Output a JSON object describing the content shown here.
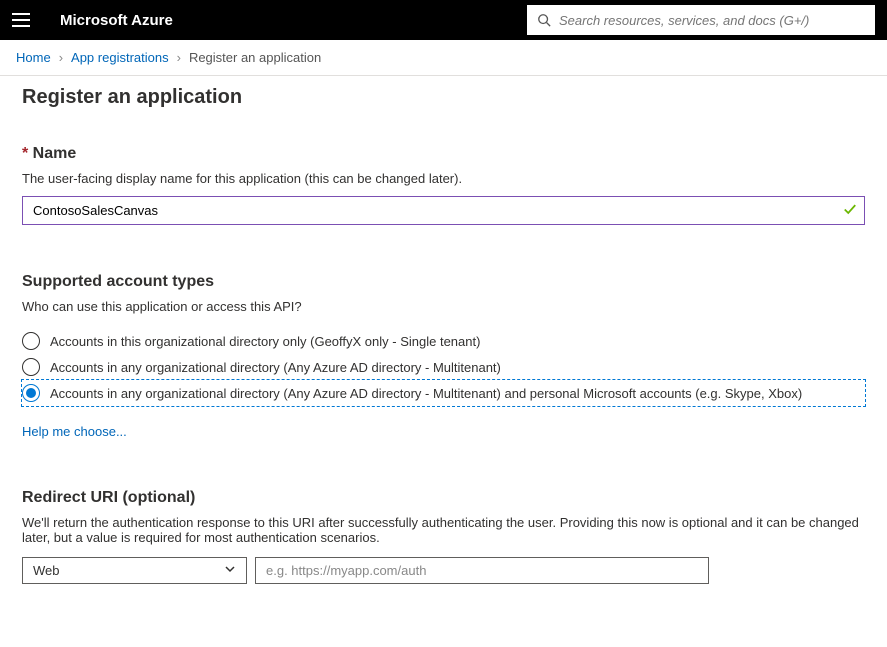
{
  "topbar": {
    "brand": "Microsoft Azure",
    "search_placeholder": "Search resources, services, and docs (G+/)"
  },
  "breadcrumb": {
    "items": [
      "Home",
      "App registrations"
    ],
    "current": "Register an application"
  },
  "page": {
    "title": "Register an application"
  },
  "name": {
    "heading": "Name",
    "desc": "The user-facing display name for this application (this can be changed later).",
    "value": "ContosoSalesCanvas"
  },
  "account_types": {
    "heading": "Supported account types",
    "desc": "Who can use this application or access this API?",
    "options": [
      "Accounts in this organizational directory only (GeoffyX only - Single tenant)",
      "Accounts in any organizational directory (Any Azure AD directory - Multitenant)",
      "Accounts in any organizational directory (Any Azure AD directory - Multitenant) and personal Microsoft accounts (e.g. Skype, Xbox)"
    ],
    "selected_index": 2,
    "help_link": "Help me choose..."
  },
  "redirect": {
    "heading": "Redirect URI (optional)",
    "desc": "We'll return the authentication response to this URI after successfully authenticating the user. Providing this now is optional and it can be changed later, but a value is required for most authentication scenarios.",
    "type_selected": "Web",
    "uri_placeholder": "e.g. https://myapp.com/auth"
  }
}
